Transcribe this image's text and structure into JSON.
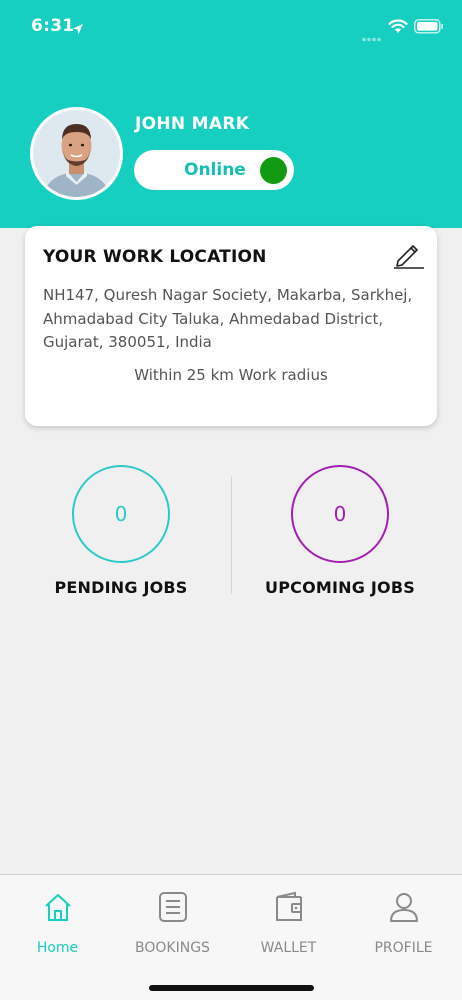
{
  "status_bar": {
    "time": "6:31",
    "icons": [
      "location-arrow-icon",
      "signal-dots-icon",
      "wifi-icon",
      "battery-icon"
    ]
  },
  "profile": {
    "name": "JOHN MARK",
    "status_label": "Online",
    "status_color": "#129a12"
  },
  "work_location": {
    "title": "YOUR WORK LOCATION",
    "address": "NH147, Quresh Nagar Society, Makarba, Sarkhej, Ahmadabad City Taluka, Ahmedabad District, Gujarat, 380051, India",
    "radius_text": "Within 25 km Work radius",
    "edit_icon": "pencil-icon"
  },
  "jobs": {
    "pending": {
      "count": "0",
      "label": "PENDING JOBS",
      "color": "#2ec9c9"
    },
    "upcoming": {
      "count": "0",
      "label": "UPCOMING JOBS",
      "color": "#a21fb2"
    }
  },
  "bottom_nav": {
    "items": [
      {
        "label": "Home",
        "icon": "home-icon",
        "active": true
      },
      {
        "label": "BOOKINGS",
        "icon": "list-icon",
        "active": false
      },
      {
        "label": "WALLET",
        "icon": "wallet-icon",
        "active": false
      },
      {
        "label": "PROFILE",
        "icon": "user-icon",
        "active": false
      }
    ]
  },
  "colors": {
    "primary": "#17cfc0",
    "background": "#f0f0f0"
  }
}
